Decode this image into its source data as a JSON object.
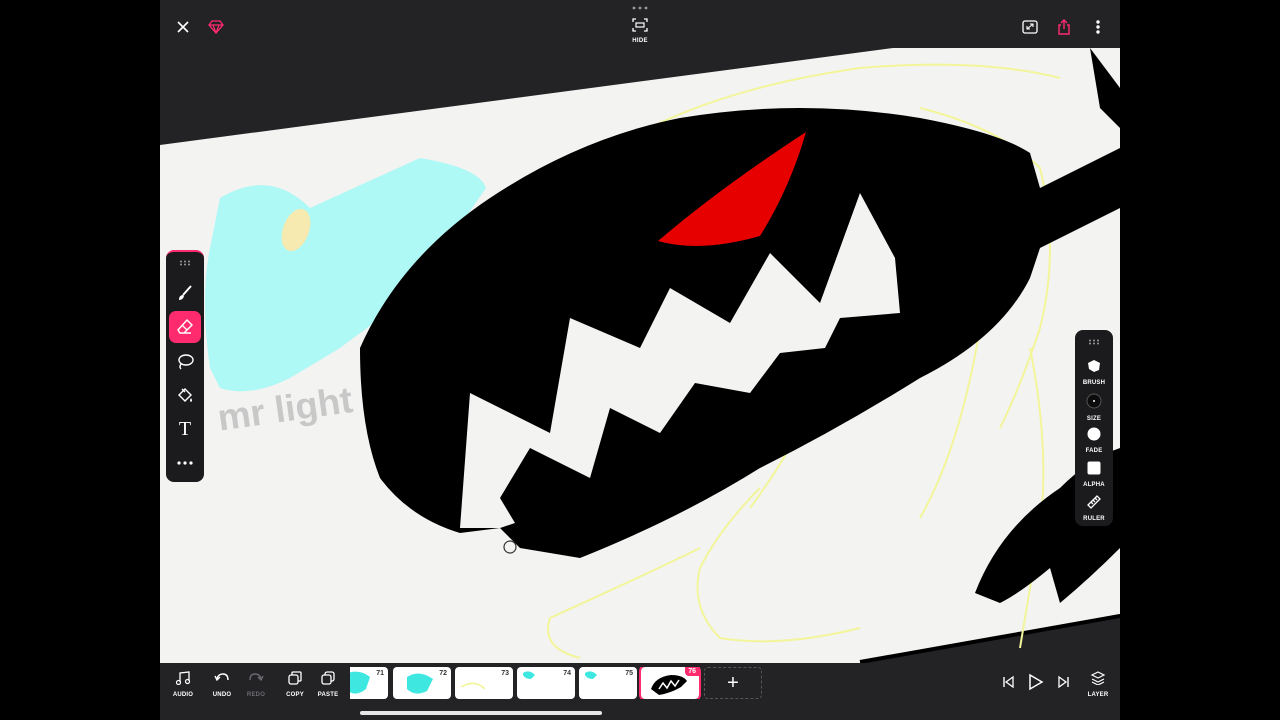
{
  "topbar": {
    "close_icon": "close-icon",
    "premium_icon": "diamond-icon",
    "hide_label": "HIDE",
    "fullscreen_icon": "expand-icon",
    "share_icon": "share-icon",
    "more_icon": "more-vertical-icon"
  },
  "canvas": {
    "text_overlay": "mr light",
    "colors": {
      "paper": "#f3f3f1",
      "ink": "#000000",
      "eye": "#e60000",
      "cyan": "#aef8f5",
      "sketch": "#f2f59a"
    }
  },
  "tool_palette": {
    "tools": [
      {
        "name": "brush",
        "icon": "brush-icon"
      },
      {
        "name": "eraser",
        "icon": "eraser-icon",
        "active": true
      },
      {
        "name": "lasso",
        "icon": "lasso-icon"
      },
      {
        "name": "fill",
        "icon": "paint-bucket-icon"
      },
      {
        "name": "text",
        "icon": "text-icon",
        "glyph": "T"
      },
      {
        "name": "more",
        "icon": "more-horizontal-icon"
      }
    ]
  },
  "brush_palette": {
    "brush_label": "BRUSH",
    "size_label": "SIZE",
    "fade_label": "FADE",
    "alpha_label": "ALPHA",
    "ruler_label": "RULER"
  },
  "bottombar": {
    "audio_label": "AUDIO",
    "undo_label": "UNDO",
    "redo_label": "REDO",
    "copy_label": "COPY",
    "paste_label": "PASTE",
    "layer_label": "LAYER",
    "add_frame_glyph": "+",
    "frames": [
      {
        "number": "71"
      },
      {
        "number": "72"
      },
      {
        "number": "73"
      },
      {
        "number": "74"
      },
      {
        "number": "75"
      },
      {
        "number": "76",
        "active": true
      }
    ]
  },
  "accent_color": "#ff2b6e"
}
